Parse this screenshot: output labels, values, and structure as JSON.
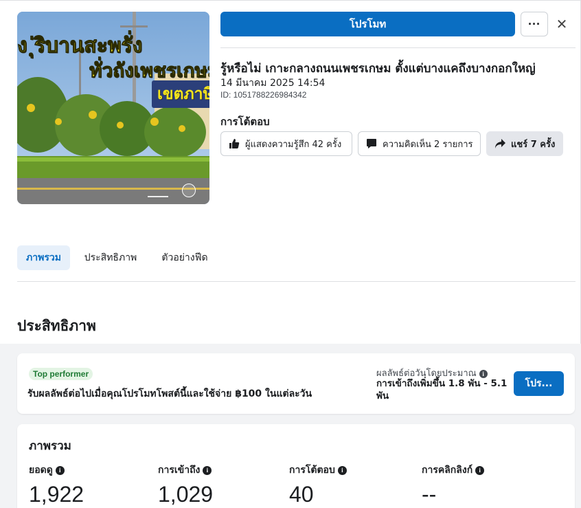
{
  "post": {
    "thumbnail": {
      "line1": "ง ุ่ริบานสะพรั่ง",
      "line2": "ทั่วถังเพชรเกษม",
      "line3": "เขตภาษีเ"
    },
    "title": "รู้หรือไม่ เกาะกลางถนนเพชรเกษม ตั้งแต่บางแคถึงบางกอกใหญ่",
    "date": "14 มีนาคม 2025 14:54",
    "id": "ID: 1051788226984342"
  },
  "header": {
    "promote_label": "โปรโมท",
    "more_label": "···",
    "close_label": "✕"
  },
  "responses": {
    "heading": "การโต้ตอบ",
    "likes": "ผู้แสดงความรู้สึก 42 ครั้ง",
    "comments": "ความคิดเห็น 2 รายการ",
    "shares": "แชร์ 7 ครั้ง"
  },
  "tabs": [
    {
      "label": "ภาพรวม",
      "active": true
    },
    {
      "label": "ประสิทธิภาพ",
      "active": false
    },
    {
      "label": "ตัวอย่างฟีด",
      "active": false
    }
  ],
  "performance": {
    "section_title": "ประสิทธิภาพ",
    "badge": "Top performer",
    "description": "รับผลลัพธ์ต่อไปเมื่อคุณโปรโมทโพสต์นี้และใช้จ่าย ฿100 ในแต่ละวัน",
    "estimate_label": "ผลลัพธ์ต่อวันโดยประมาณ",
    "estimate_value": "การเข้าถึงเพิ่มขึ้น 1.8 พัน - 5.1 พัน",
    "button_label": "โปร..."
  },
  "overview": {
    "title": "ภาพรวม",
    "metrics": [
      {
        "label": "ยอดดู",
        "value": "1,922"
      },
      {
        "label": "การเข้าถึง",
        "value": "1,029"
      },
      {
        "label": "การโต้ตอบ",
        "value": "40"
      },
      {
        "label": "การคลิกลิงก์",
        "value": "--"
      }
    ]
  },
  "colors": {
    "accent": "#0a6ec2",
    "badge_bg": "#e3f4e4",
    "badge_text": "#1e7a34",
    "tab_active_bg": "#e7f0fa"
  },
  "icons": {
    "likes": "thumbs-up-icon",
    "comments": "comment-icon",
    "shares": "share-arrow-icon",
    "info": "info-icon",
    "more": "more-dots-icon",
    "close": "close-icon"
  }
}
